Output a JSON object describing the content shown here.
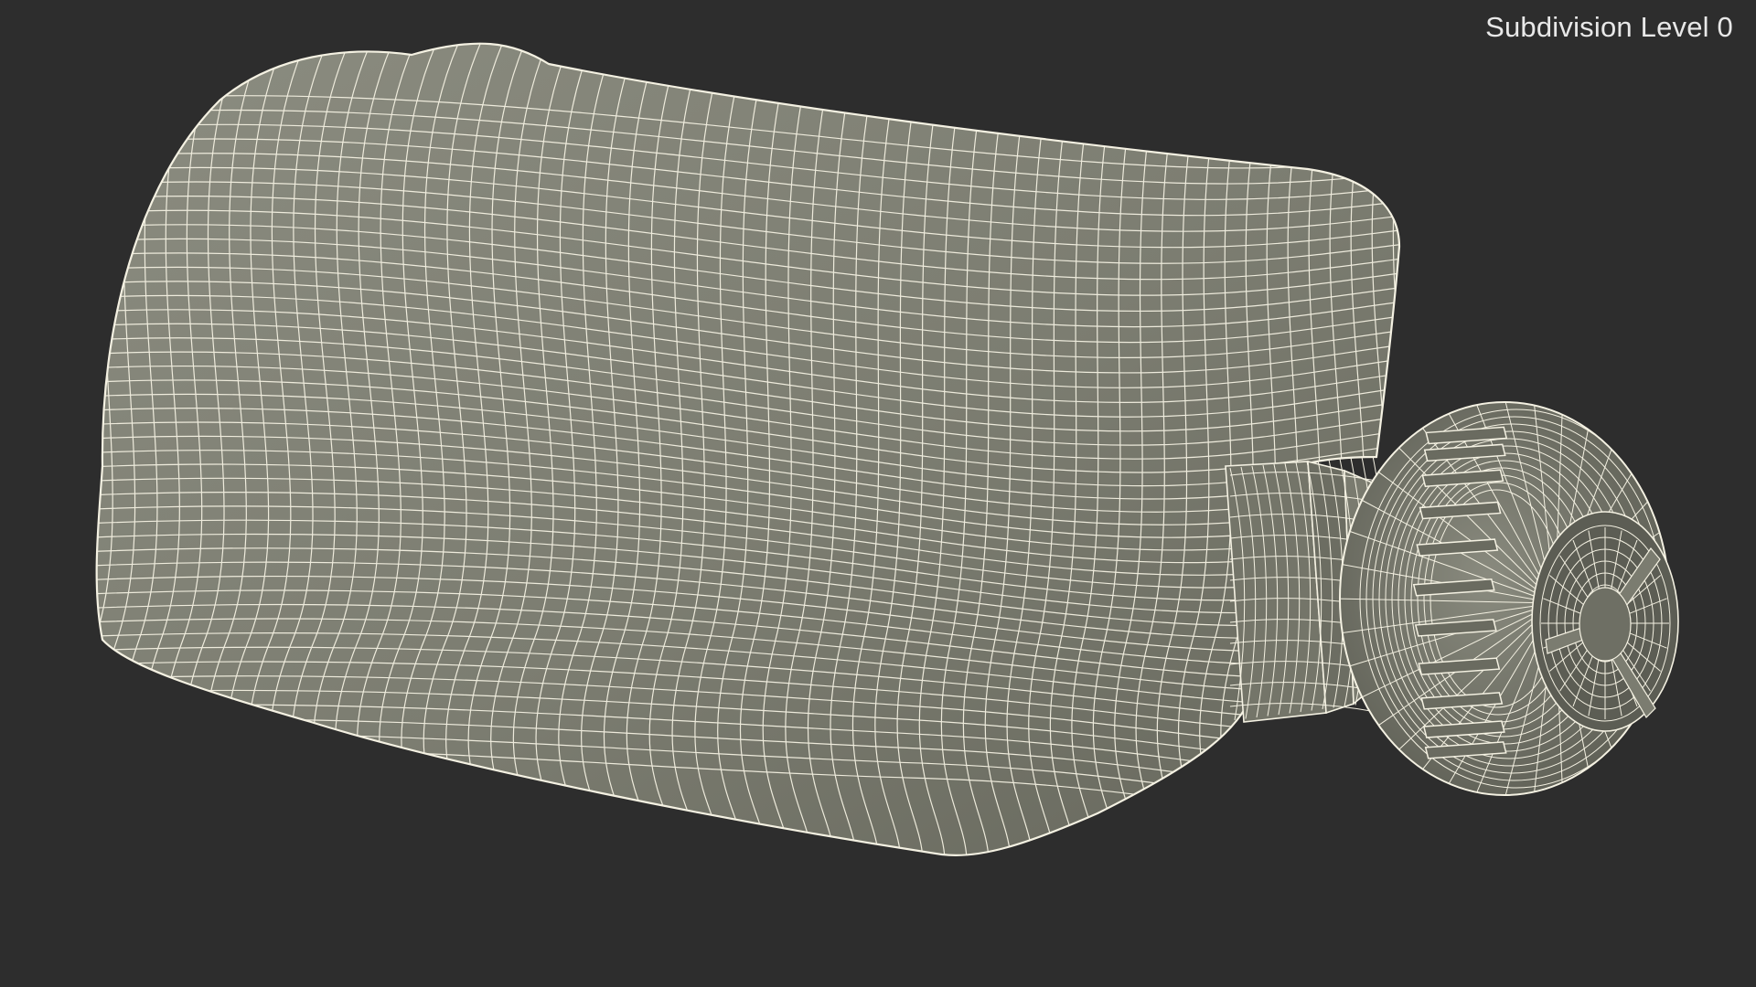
{
  "overlay": {
    "subdivision_label": "Subdivision Level 0"
  },
  "scene": {
    "object_icon": "wireframe-bottle-model",
    "colors": {
      "background": "#2d2d2d",
      "surface": "#7d7e72",
      "surface_light": "#8b8c80",
      "surface_dark": "#63645a",
      "wire": "#f4f1e2"
    }
  }
}
